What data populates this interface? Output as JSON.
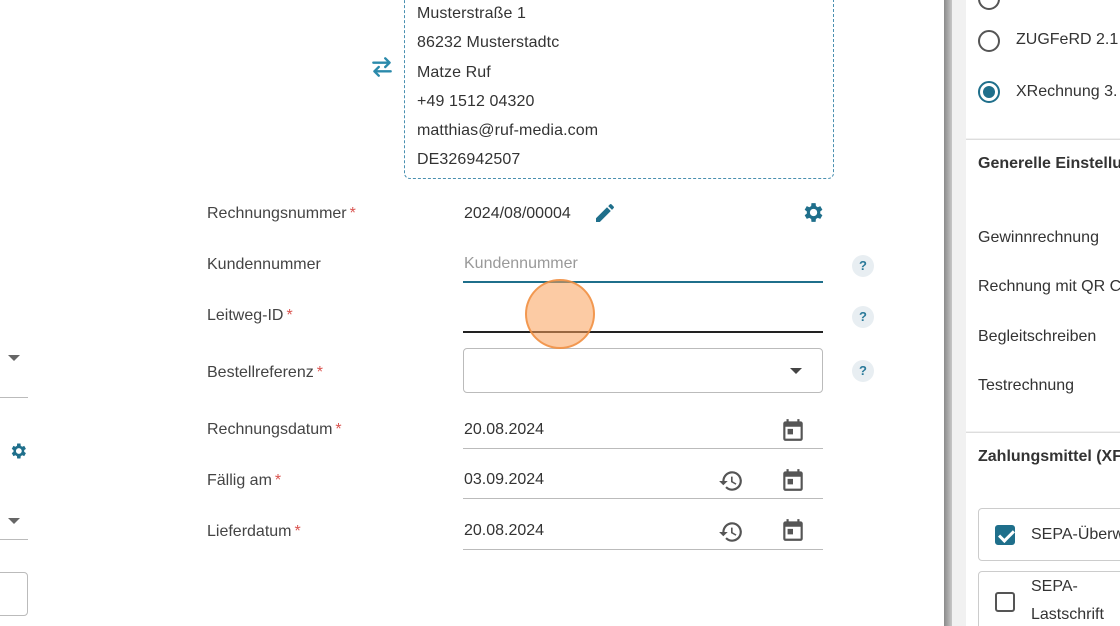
{
  "address": {
    "lines": [
      "Musterstraße 1",
      "86232 Musterstadtc",
      "Matze Ruf",
      "+49 1512 04320",
      "matthias@ruf-media.com",
      "DE326942507"
    ]
  },
  "form": {
    "invoice_number": {
      "label": "Rechnungsnummer",
      "required": "*",
      "value": "2024/08/00004"
    },
    "customer_number": {
      "label": "Kundennummer",
      "placeholder": "Kundennummer",
      "value": ""
    },
    "leitweg_id": {
      "label": "Leitweg-ID",
      "required": "*",
      "value": ""
    },
    "order_reference": {
      "label": "Bestellreferenz",
      "required": "*",
      "value": ""
    },
    "invoice_date": {
      "label": "Rechnungsdatum",
      "required": "*",
      "value": "20.08.2024"
    },
    "due_date": {
      "label": "Fällig am",
      "required": "*",
      "value": "03.09.2024"
    },
    "delivery_date": {
      "label": "Lieferdatum",
      "required": "*",
      "value": "20.08.2024"
    },
    "help_glyph": "?"
  },
  "right_panel": {
    "formats": [
      {
        "label": "ZUGFeRD 2.1",
        "selected": false
      },
      {
        "label": "XRechnung 3.",
        "selected": true
      }
    ],
    "general_settings_title": "Generelle Einstellu",
    "general_settings": [
      "Gewinnrechnung",
      "Rechnung mit QR C",
      "Begleitschreiben",
      "Testrechnung"
    ],
    "payment_title": "Zahlungsmittel (XF",
    "payment_methods": [
      {
        "label": "SEPA-Überw",
        "checked": true
      },
      {
        "label": "SEPA-Lastschrift",
        "line1": "SEPA-",
        "line2": "Lastschrift",
        "checked": false
      }
    ]
  },
  "colors": {
    "accent": "#1f6f8b",
    "required": "#d9534f",
    "help_bg": "#e8eef2"
  },
  "icons": {
    "swap": "swap-arrows-icon",
    "edit": "pencil-icon",
    "settings": "gear-icon",
    "calendar": "calendar-icon",
    "history": "history-icon",
    "dropdown": "chevron-down-icon"
  }
}
